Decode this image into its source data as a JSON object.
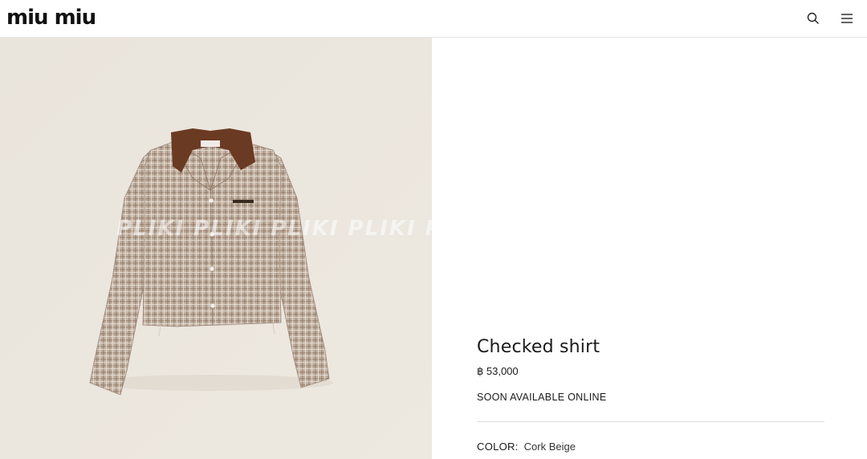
{
  "header": {
    "logo": "miu miu",
    "icons": [
      "search-icon",
      "menu-icon"
    ]
  },
  "image": {
    "watermark": "PLIKI   PLIKI   PLIKI   PLIKI   PLI",
    "collar_label": "miu miu",
    "embroidery": "miu miu"
  },
  "product": {
    "name": "Checked shirt",
    "price": "฿ 53,000",
    "availability": "SOON AVAILABLE ONLINE",
    "color_label": "COLOR:",
    "color_value": "Cork Beige"
  },
  "colors": {
    "background": "#ece7df",
    "shirt": "#b9a99a",
    "collar": "#6b3a22"
  }
}
